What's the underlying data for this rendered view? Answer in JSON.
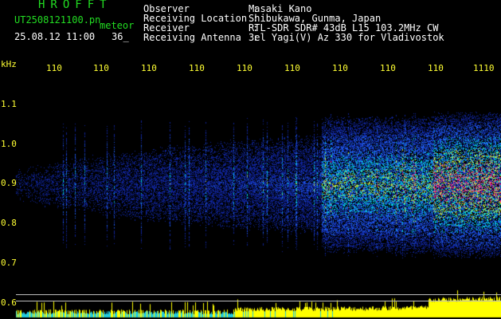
{
  "header": {
    "logo": "HROFFT",
    "filename": "UT2508121100.pn",
    "tag": "meteor",
    "datetime": "25.08.12 11:00",
    "number": "36_",
    "info_labels": "Observer           : \nReceiving Location : \nReceiver           : \nReceiving Antenna  : ",
    "info_values": "Masaki Kano\nShibukawa, Gunma, Japan\nRTL-SDR SDR# 43dB L15 103.2MHz CW\n3el Yagi(V) Az 330 for Vladivostok"
  },
  "x_axis": {
    "ticks": [
      "110",
      "110",
      "110",
      "110",
      "110",
      "110",
      "110",
      "110",
      "110",
      "1110"
    ]
  },
  "y_axis": {
    "unit": "kHz",
    "ticks": [
      "1.1",
      "1.0",
      "0.9",
      "0.8",
      "0.7",
      "0.6"
    ]
  },
  "colors": {
    "background": "#000000",
    "label_yellow": "#ffff33",
    "logo_green": "#22dd22",
    "low_signal": "#1030c8",
    "mid_signal": "#00d0d0",
    "high_signal": "#ff2a7a",
    "amplitude_cyan": "#22ccdd",
    "amplitude_yellow": "#ffff00"
  }
}
